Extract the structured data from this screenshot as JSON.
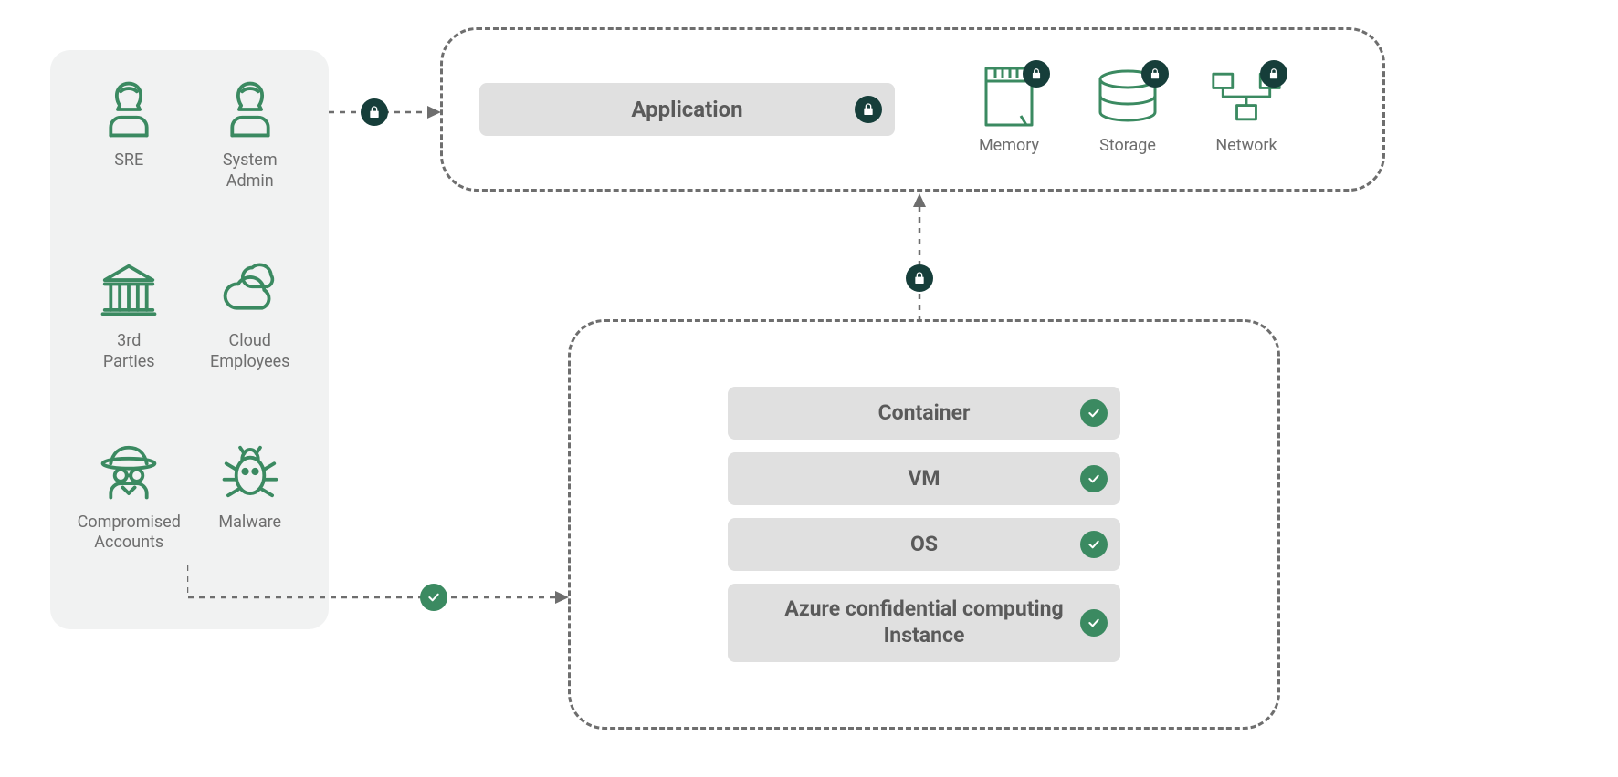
{
  "threats": {
    "items": [
      {
        "label": "SRE",
        "icon": "person"
      },
      {
        "label": "System\nAdmin",
        "icon": "person"
      },
      {
        "label": "3rd\nParties",
        "icon": "institution"
      },
      {
        "label": "Cloud\nEmployees",
        "icon": "clouds"
      },
      {
        "label": "Compromised\nAccounts",
        "icon": "spy"
      },
      {
        "label": "Malware",
        "icon": "bug"
      }
    ]
  },
  "application_row": {
    "app_label": "Application",
    "resources": [
      {
        "label": "Memory",
        "icon": "memory"
      },
      {
        "label": "Storage",
        "icon": "storage"
      },
      {
        "label": "Network",
        "icon": "network"
      }
    ]
  },
  "stack": {
    "items": [
      {
        "label": "Container"
      },
      {
        "label": "VM"
      },
      {
        "label": "OS"
      },
      {
        "label": "Azure confidential computing Instance"
      }
    ]
  }
}
